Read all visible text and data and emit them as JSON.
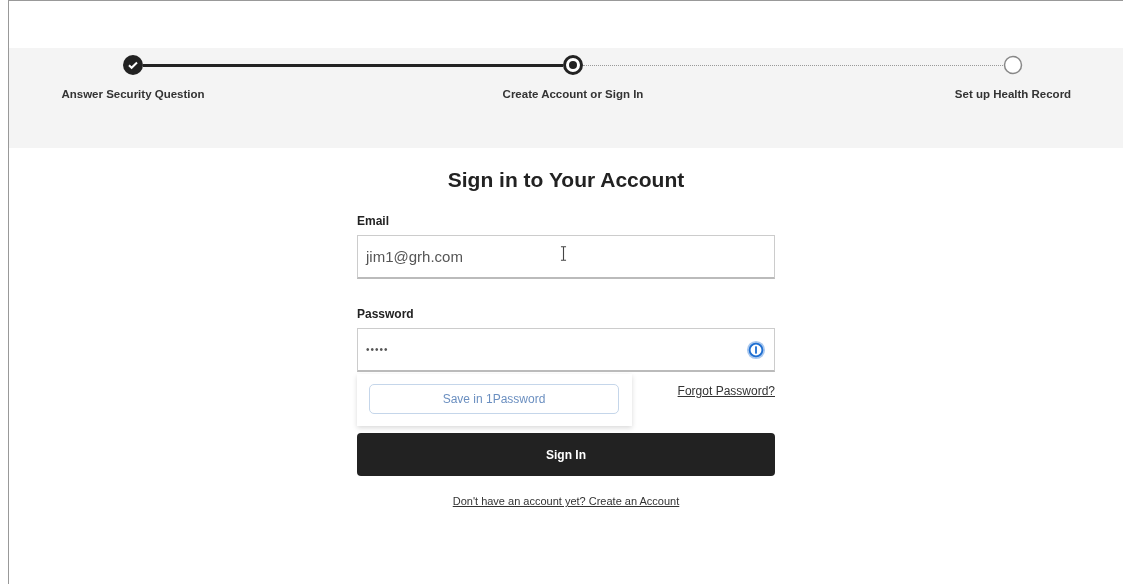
{
  "steps": [
    {
      "label": "Answer Security Question",
      "kind": "done"
    },
    {
      "label": "Create Account or Sign In",
      "kind": "current"
    },
    {
      "label": "Set up Health Record",
      "kind": "upcoming"
    }
  ],
  "title": "Sign in to Your Account",
  "fields": [
    {
      "label": "Email",
      "value": "jim1@grh.com",
      "kind": "email"
    },
    {
      "label": "Password",
      "value": "•••••",
      "kind": "password"
    }
  ],
  "password_popup": {
    "button": "Save in 1Password"
  },
  "forgot_link": "Forgot Password?",
  "submit": "Sign In",
  "create_link": "Don't have an account yet? Create an Account"
}
